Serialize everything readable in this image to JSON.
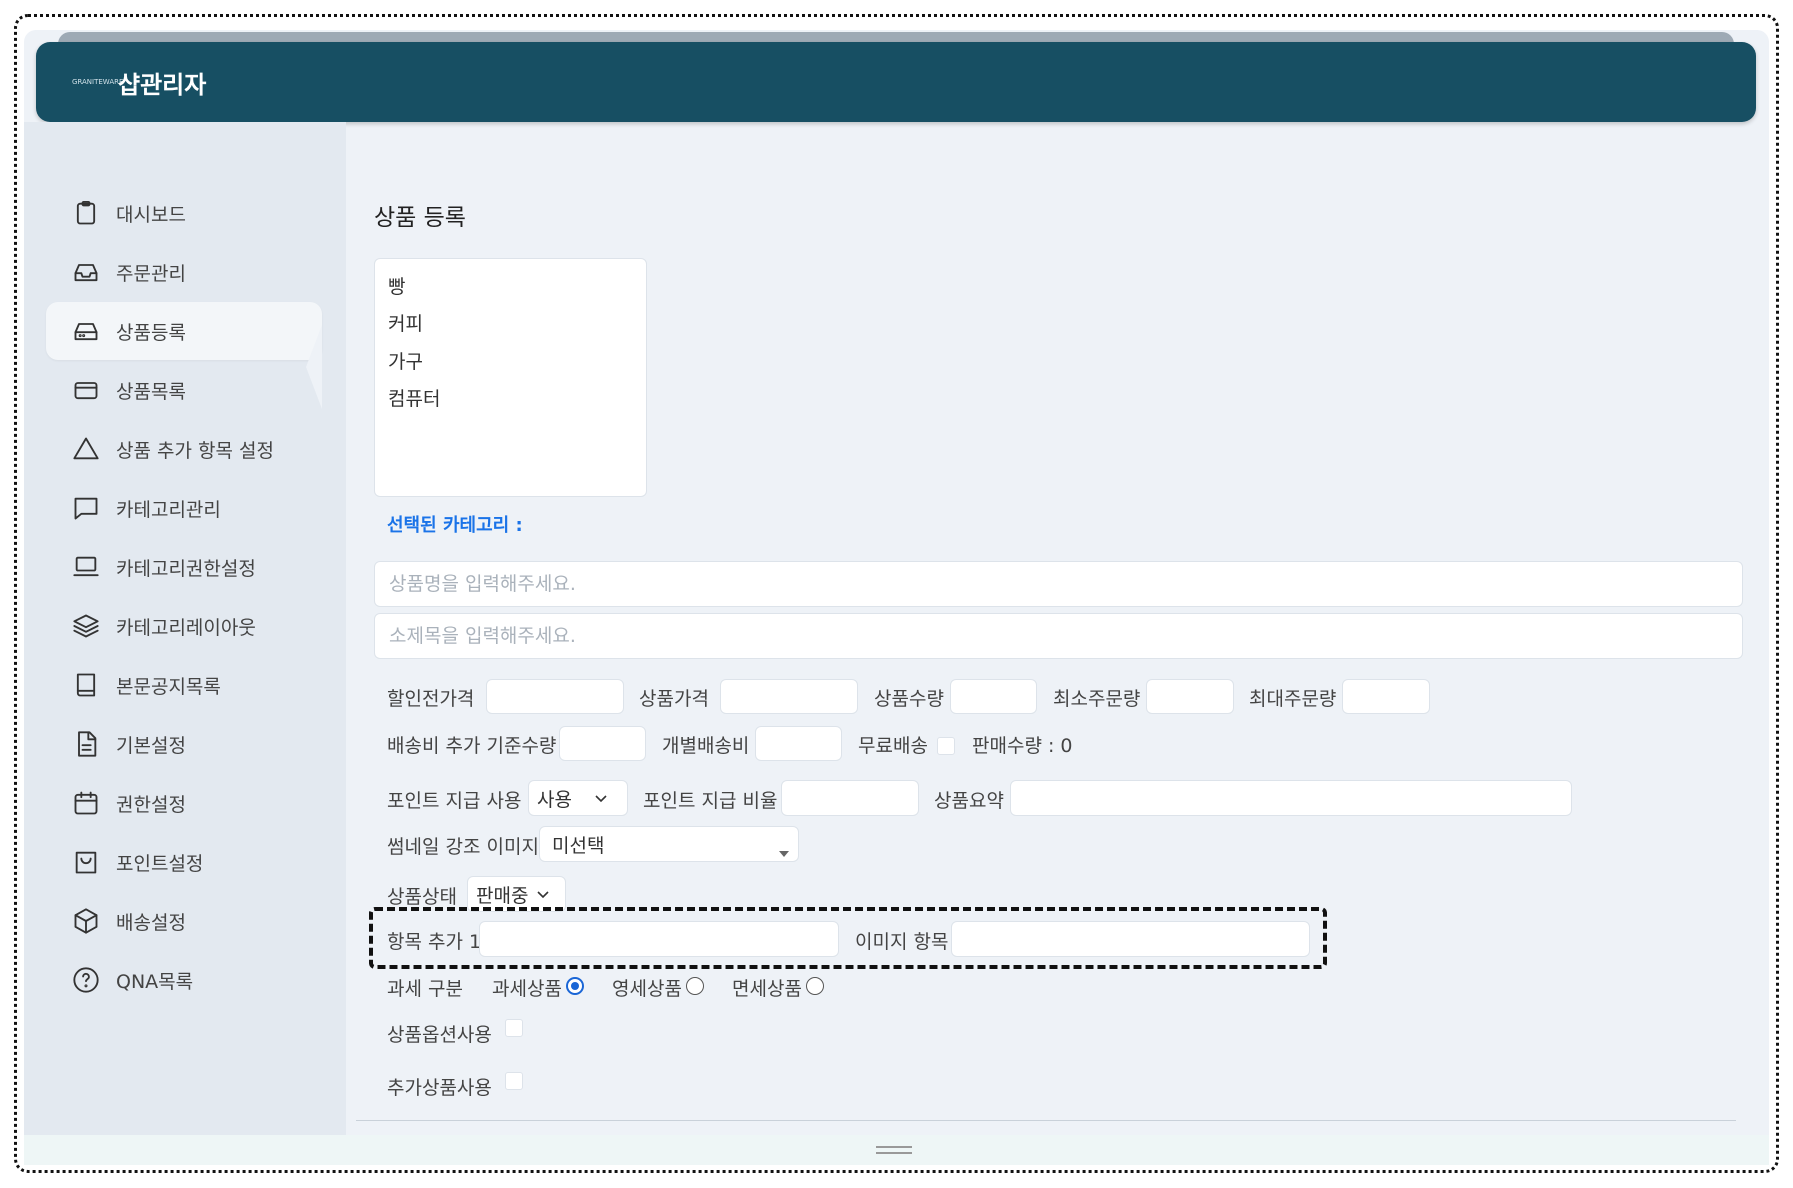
{
  "header": {
    "logo_text": "GRANITEWARE",
    "title": "샵관리자"
  },
  "sidebar": {
    "items": [
      {
        "label": "대시보드",
        "icon": "clipboard-icon"
      },
      {
        "label": "주문관리",
        "icon": "inbox-icon"
      },
      {
        "label": "상품등록",
        "icon": "hard-drive-icon",
        "active": true
      },
      {
        "label": "상품목록",
        "icon": "credit-card-icon"
      },
      {
        "label": "상품 추가 항목 설정",
        "icon": "triangle-icon"
      },
      {
        "label": "카테고리관리",
        "icon": "message-square-icon"
      },
      {
        "label": "카테고리권한설정",
        "icon": "laptop-icon"
      },
      {
        "label": "카테고리레이아웃",
        "icon": "layers-icon"
      },
      {
        "label": "본문공지목록",
        "icon": "book-icon"
      },
      {
        "label": "기본설정",
        "icon": "file-text-icon"
      },
      {
        "label": "권한설정",
        "icon": "calendar-icon"
      },
      {
        "label": "포인트설정",
        "icon": "shopping-bag-icon"
      },
      {
        "label": "배송설정",
        "icon": "box-icon"
      },
      {
        "label": "QNA목록",
        "icon": "help-circle-icon"
      }
    ]
  },
  "main": {
    "title": "상품 등록",
    "categories": [
      "빵",
      "커피",
      "가구",
      "컴퓨터"
    ],
    "selected_category_label": "선택된 카테고리 :",
    "product_name_placeholder": "상품명을 입력해주세요.",
    "subtitle_placeholder": "소제목을 입력해주세요.",
    "labels": {
      "price_before_discount": "할인전가격",
      "price": "상품가격",
      "quantity": "상품수량",
      "min_order": "최소주문량",
      "max_order": "최대주문량",
      "shipping_threshold": "배송비 추가 기준수량",
      "individual_shipping": "개별배송비",
      "free_shipping": "무료배송",
      "sales_count": "판매수량 : 0",
      "point_use": "포인트 지급 사용",
      "point_rate": "포인트 지급 비율",
      "summary": "상품요약",
      "thumbnail_highlight": "썸네일 강조 이미지",
      "status": "상품상태",
      "extra_item": "항목 추가 1",
      "image_item": "이미지 항목",
      "tax_type": "과세 구분",
      "taxable": "과세상품",
      "zero_rated": "영세상품",
      "tax_free": "면세상품",
      "option_use": "상품옵션사용",
      "addon_use": "추가상품사용"
    },
    "point_use_value": "사용",
    "thumbnail_value": "미선택",
    "status_value": "판매중",
    "tax_selected": "과세상품"
  },
  "colors": {
    "header_bg": "#174f63",
    "accent_blue": "#1a73e8",
    "radio_blue": "#1a66d6"
  }
}
